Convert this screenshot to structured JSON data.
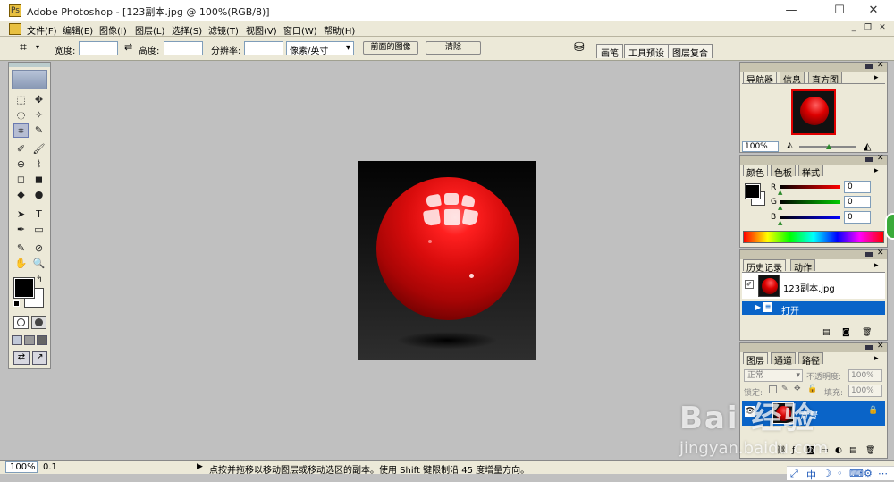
{
  "window": {
    "title": "Adobe Photoshop - [123副本.jpg @ 100%(RGB/8)]",
    "app_icon": "Ps",
    "minimize": "—",
    "maximize": "☐",
    "close": "✕"
  },
  "menu": {
    "items": [
      "文件(F)",
      "编辑(E)",
      "图像(I)",
      "图层(L)",
      "选择(S)",
      "滤镜(T)",
      "视图(V)",
      "窗口(W)",
      "帮助(H)"
    ],
    "doc_controls": [
      "_",
      "❐",
      "✕"
    ]
  },
  "options_bar": {
    "width_label": "宽度:",
    "height_label": "高度:",
    "resolution_label": "分辨率:",
    "unit_select": "像素/英寸",
    "front_image_button": "前面的图像",
    "clear_button": "清除",
    "palette_tabs": [
      "画笔",
      "工具预设",
      "图层复合"
    ]
  },
  "toolbox": {
    "tools": [
      "⬚",
      "✥",
      "◌",
      "✧",
      "⌗",
      "✎",
      "✐",
      "🖌",
      "⊕",
      "⌇",
      "◻",
      "◼",
      "◆",
      "●",
      "➤",
      "T",
      "✒",
      "▭",
      "✎",
      "⊘",
      "✋",
      "🔍"
    ],
    "icons": [
      "rect-marquee-icon",
      "move-icon",
      "lasso-icon",
      "magic-wand-icon",
      "crop-icon",
      "slice-icon",
      "healing-brush-icon",
      "brush-icon",
      "clone-stamp-icon",
      "history-brush-icon",
      "eraser-icon",
      "gradient-icon",
      "blur-icon",
      "dodge-icon",
      "path-select-icon",
      "type-icon",
      "pen-icon",
      "shape-icon",
      "notes-icon",
      "eyedropper-icon",
      "hand-icon",
      "zoom-icon"
    ],
    "fg_color": "#000000",
    "bg_color": "#ffffff"
  },
  "navigator": {
    "tabs": [
      "导航器",
      "信息",
      "直方图"
    ],
    "zoom": "100%"
  },
  "color_panel": {
    "tabs": [
      "颜色",
      "色板",
      "样式"
    ],
    "channels": [
      {
        "label": "R",
        "value": "0",
        "color": "#c00000"
      },
      {
        "label": "G",
        "value": "0",
        "color": "#00a000"
      },
      {
        "label": "B",
        "value": "0",
        "color": "#0000c0"
      }
    ]
  },
  "history_panel": {
    "tabs": [
      "历史记录",
      "动作"
    ],
    "snapshot_name": "123副本.jpg",
    "open_step": "打开"
  },
  "layers_panel": {
    "tabs": [
      "图层",
      "通道",
      "路径"
    ],
    "blend_mode": "正常",
    "opacity_label": "不透明度:",
    "opacity_value": "100%",
    "lock_label": "锁定:",
    "fill_label": "填充:",
    "fill_value": "100%",
    "layer_name": "背景"
  },
  "status": {
    "zoom": "100%",
    "doc_info": "0.1",
    "hint": "点按并拖移以移动图层或移动选区的副本。使用 Shift 键限制沿 45 度增量方向。"
  },
  "taskstrip": {
    "items": [
      "⤢",
      "中",
      "☽",
      "◦",
      "⌨",
      "⚙",
      "⋯"
    ]
  },
  "watermark": {
    "main": "Bai 经验",
    "url": "jingyan.baidu.com"
  },
  "colors": {
    "selection_blue": "#0a64c8",
    "ps_gray": "#c0c0c0",
    "panel_bg": "#ece9d8"
  }
}
